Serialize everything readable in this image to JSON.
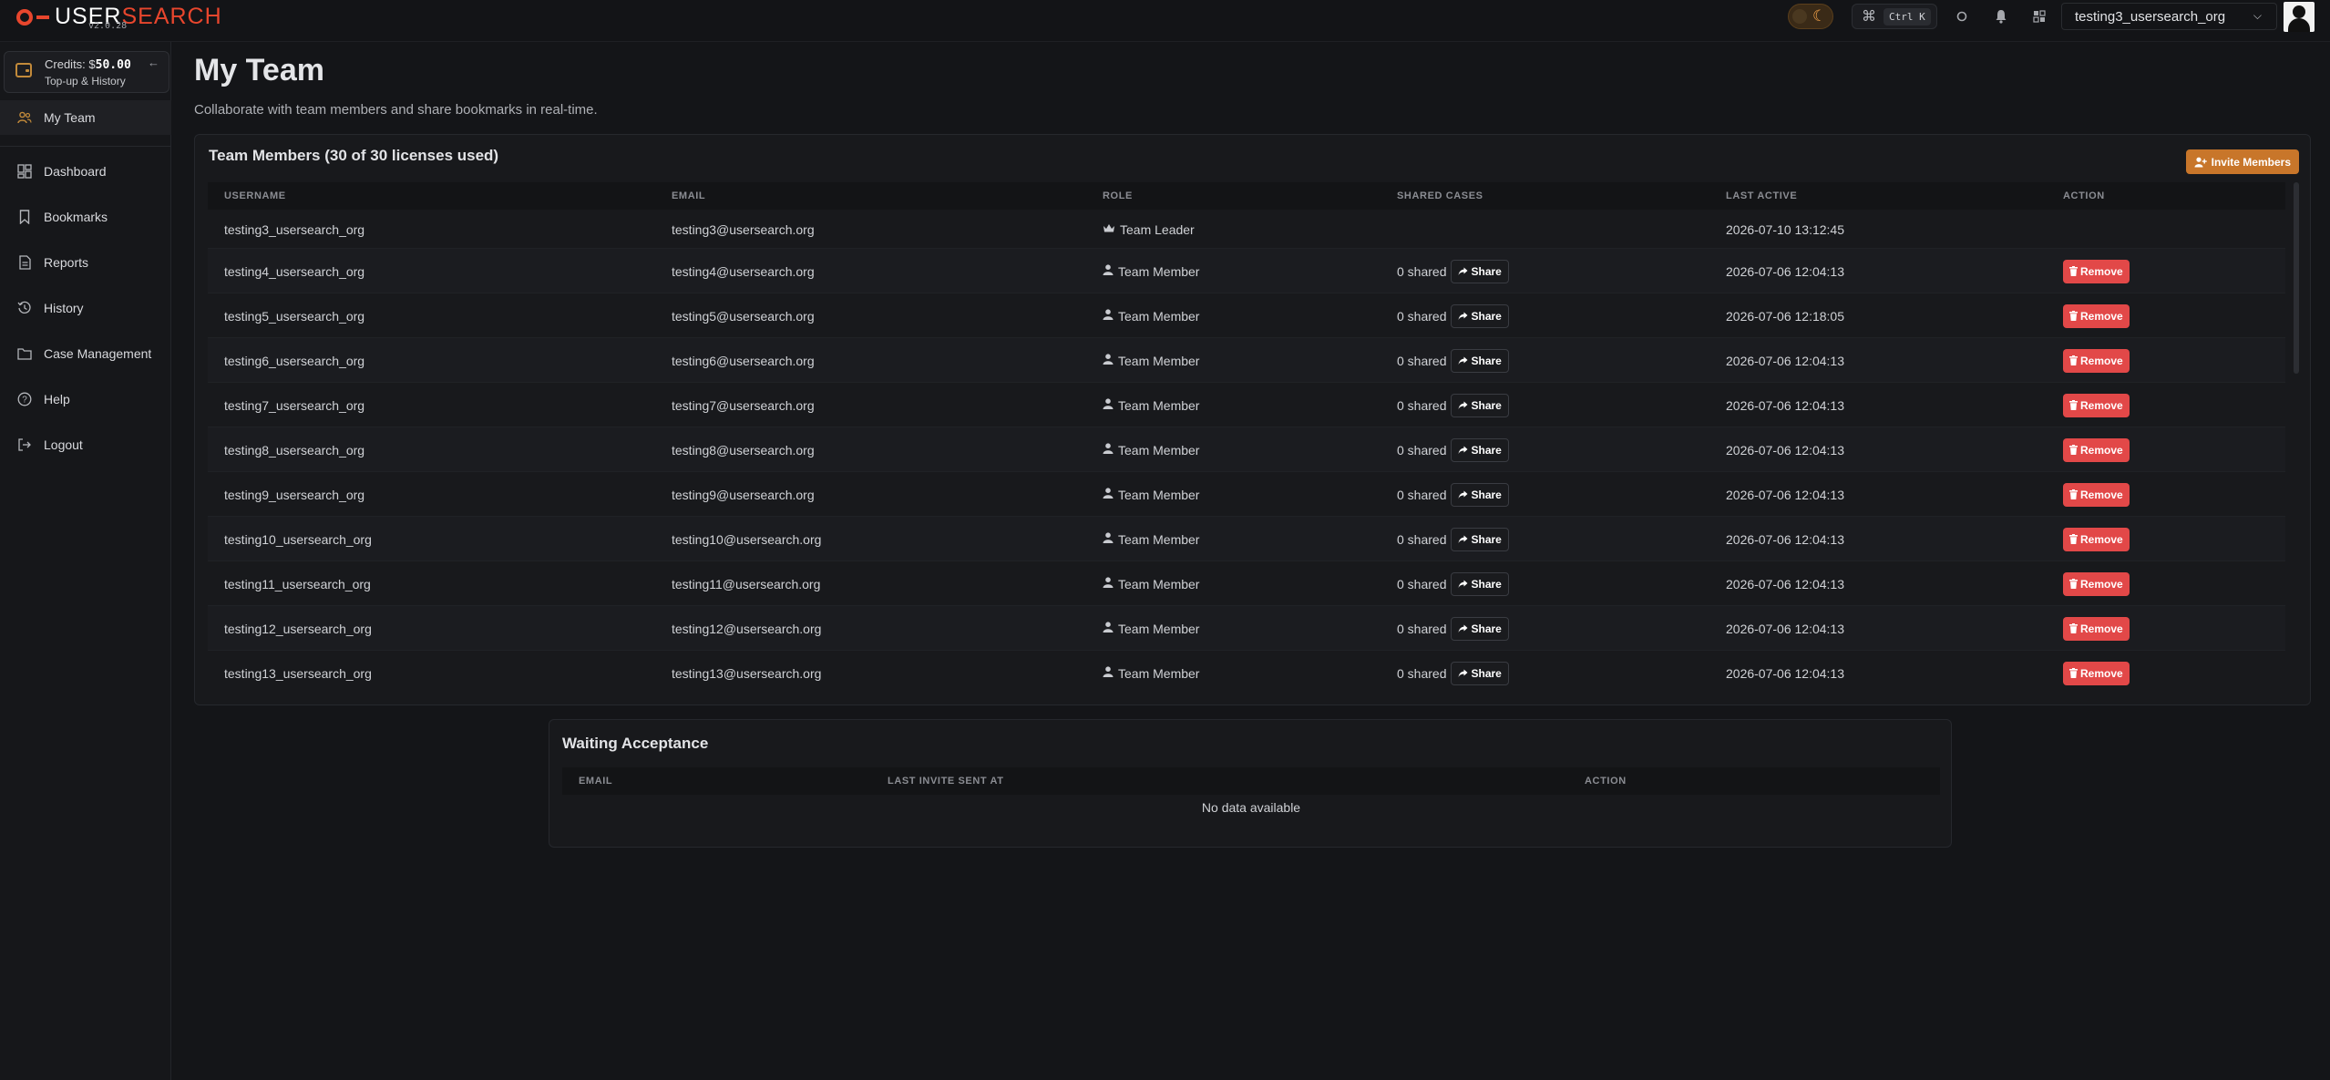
{
  "app": {
    "logo_prefix": "USER",
    "logo_suffix": "SEARCH",
    "version": "v2.0.28"
  },
  "topbar": {
    "shortcut_cmd": "⌘",
    "shortcut_keys": "Ctrl K",
    "username": "testing3_usersearch_org"
  },
  "sidebar": {
    "credits_label": "Credits: $",
    "credits_amount": "50.00",
    "topup_label": "Top-up & History",
    "items": [
      {
        "label": "My Team",
        "icon": "team-icon",
        "active": true
      },
      {
        "label": "Dashboard",
        "icon": "dashboard-icon"
      },
      {
        "label": "Bookmarks",
        "icon": "bookmark-icon"
      },
      {
        "label": "Reports",
        "icon": "reports-icon"
      },
      {
        "label": "History",
        "icon": "history-icon"
      },
      {
        "label": "Case Management",
        "icon": "folder-icon"
      },
      {
        "label": "Help",
        "icon": "help-icon"
      },
      {
        "label": "Logout",
        "icon": "logout-icon"
      }
    ]
  },
  "page": {
    "title": "My Team",
    "subtitle": "Collaborate with team members and share bookmarks in real-time."
  },
  "members": {
    "title": "Team Members (30 of 30 licenses used)",
    "invite_label": "Invite Members",
    "columns": [
      "USERNAME",
      "EMAIL",
      "ROLE",
      "SHARED CASES",
      "LAST ACTIVE",
      "ACTION"
    ],
    "share_label": "Share",
    "remove_label": "Remove",
    "rows": [
      {
        "username": "testing3_usersearch_org",
        "email": "testing3@usersearch.org",
        "role": "Team Leader",
        "shared": "",
        "last_active": "2026-07-10 13:12:45"
      },
      {
        "username": "testing4_usersearch_org",
        "email": "testing4@usersearch.org",
        "role": "Team Member",
        "shared": "0 shared",
        "last_active": "2026-07-06 12:04:13"
      },
      {
        "username": "testing5_usersearch_org",
        "email": "testing5@usersearch.org",
        "role": "Team Member",
        "shared": "0 shared",
        "last_active": "2026-07-06 12:18:05"
      },
      {
        "username": "testing6_usersearch_org",
        "email": "testing6@usersearch.org",
        "role": "Team Member",
        "shared": "0 shared",
        "last_active": "2026-07-06 12:04:13"
      },
      {
        "username": "testing7_usersearch_org",
        "email": "testing7@usersearch.org",
        "role": "Team Member",
        "shared": "0 shared",
        "last_active": "2026-07-06 12:04:13"
      },
      {
        "username": "testing8_usersearch_org",
        "email": "testing8@usersearch.org",
        "role": "Team Member",
        "shared": "0 shared",
        "last_active": "2026-07-06 12:04:13"
      },
      {
        "username": "testing9_usersearch_org",
        "email": "testing9@usersearch.org",
        "role": "Team Member",
        "shared": "0 shared",
        "last_active": "2026-07-06 12:04:13"
      },
      {
        "username": "testing10_usersearch_org",
        "email": "testing10@usersearch.org",
        "role": "Team Member",
        "shared": "0 shared",
        "last_active": "2026-07-06 12:04:13"
      },
      {
        "username": "testing11_usersearch_org",
        "email": "testing11@usersearch.org",
        "role": "Team Member",
        "shared": "0 shared",
        "last_active": "2026-07-06 12:04:13"
      },
      {
        "username": "testing12_usersearch_org",
        "email": "testing12@usersearch.org",
        "role": "Team Member",
        "shared": "0 shared",
        "last_active": "2026-07-06 12:04:13"
      },
      {
        "username": "testing13_usersearch_org",
        "email": "testing13@usersearch.org",
        "role": "Team Member",
        "shared": "0 shared",
        "last_active": "2026-07-06 12:04:13"
      }
    ]
  },
  "waiting": {
    "title": "Waiting Acceptance",
    "columns": [
      "EMAIL",
      "LAST INVITE SENT AT",
      "ACTION"
    ],
    "empty_text": "No data available"
  },
  "colors": {
    "accent": "#c8762a",
    "brand": "#e8462d",
    "danger": "#e24848",
    "background": "#141518"
  }
}
